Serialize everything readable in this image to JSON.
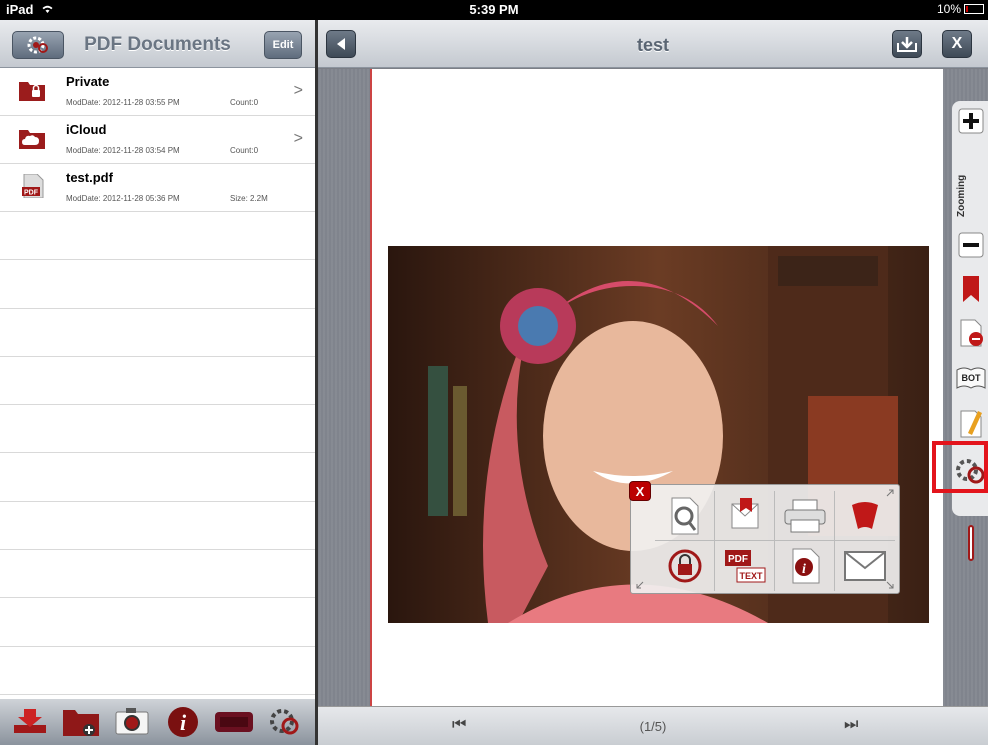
{
  "statusbar": {
    "carrier": "iPad",
    "time": "5:39 PM",
    "battery": "10%"
  },
  "left_panel": {
    "title": "PDF Documents",
    "edit_label": "Edit",
    "files": [
      {
        "name": "Private",
        "date": "ModDate: 2012-11-28 03:55 PM",
        "extra": "Count:0",
        "icon": "locked-folder-icon",
        "chevron": ">"
      },
      {
        "name": "iCloud",
        "date": "ModDate: 2012-11-28 03:54 PM",
        "extra": "Count:0",
        "icon": "cloud-folder-icon",
        "chevron": ">"
      },
      {
        "name": "test.pdf",
        "date": "ModDate: 2012-11-28 05:36 PM",
        "extra": "Size: 2.2M",
        "icon": "pdf-file-icon",
        "chevron": ""
      }
    ],
    "toolbar": [
      "import-icon",
      "new-folder-icon",
      "camera-icon",
      "info-icon",
      "keyboard-icon",
      "settings-icon"
    ]
  },
  "viewer": {
    "title": "test",
    "zoom_label": "Zooming",
    "page_indicator": "(1/5)",
    "first_label": "⏮",
    "last_label": "⏭",
    "close_label": "X",
    "popup_close_label": "X",
    "popup_items": [
      "search-icon",
      "bookmark-mail-icon",
      "print-icon",
      "bookmark-icon",
      "lock-icon",
      "pdf-to-text-icon",
      "info-icon",
      "email-icon"
    ],
    "pdf_text_label": "PDF",
    "text_label": "TEXT",
    "bot_label": "BOT"
  },
  "colors": {
    "accent": "#a01818",
    "highlight": "#e3141c"
  }
}
